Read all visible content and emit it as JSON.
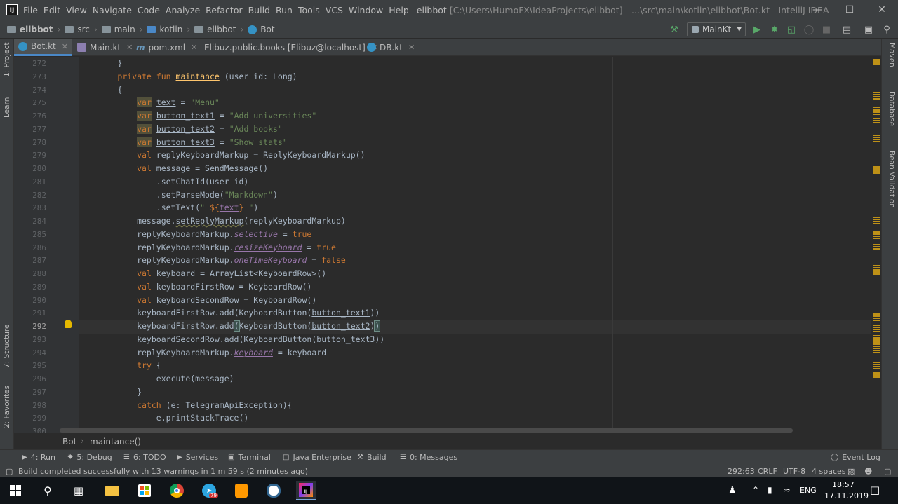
{
  "window": {
    "menu": [
      "File",
      "Edit",
      "View",
      "Navigate",
      "Code",
      "Analyze",
      "Refactor",
      "Build",
      "Run",
      "Tools",
      "VCS",
      "Window",
      "Help"
    ],
    "title_project": "elibbot",
    "title_path": "[C:\\Users\\HumoFX\\IdeaProjects\\elibbot] - ...\\src\\main\\kotlin\\elibbot\\Bot.kt - IntelliJ IDEA",
    "logo_text": "IJ"
  },
  "breadcrumbs": [
    "elibbot",
    "src",
    "main",
    "kotlin",
    "elibbot",
    "Bot"
  ],
  "run_config": "MainKt",
  "tabs": [
    {
      "label": "Bot.kt",
      "active": true
    },
    {
      "label": "Main.kt",
      "active": false
    },
    {
      "label": "pom.xml",
      "active": false
    },
    {
      "label": "Elibuz.public.books [Elibuz@localhost]",
      "active": false
    },
    {
      "label": "DB.kt",
      "active": false
    }
  ],
  "side_left": [
    "1: Project",
    "Learn",
    "7: Structure",
    "2: Favorites"
  ],
  "side_right": [
    "Maven",
    "Database",
    "Bean Validation"
  ],
  "editor": {
    "current_line": 292,
    "lines": [
      {
        "n": "272",
        "c": "        }"
      },
      {
        "n": "273",
        "c": "        private fun maintance (user_id: Long)"
      },
      {
        "n": "274",
        "c": "        {"
      },
      {
        "n": "275",
        "c": "            var text = \"Menu\""
      },
      {
        "n": "276",
        "c": "            var button_text1 = \"Add universities\""
      },
      {
        "n": "277",
        "c": "            var button_text2 = \"Add books\""
      },
      {
        "n": "278",
        "c": "            var button_text3 = \"Show stats\""
      },
      {
        "n": "279",
        "c": "            val replyKeyboardMarkup = ReplyKeyboardMarkup()"
      },
      {
        "n": "280",
        "c": "            val message = SendMessage()"
      },
      {
        "n": "281",
        "c": "                .setChatId(user_id)"
      },
      {
        "n": "282",
        "c": "                .setParseMode(\"Markdown\")"
      },
      {
        "n": "283",
        "c": "                .setText(\"_${text}_\")"
      },
      {
        "n": "284",
        "c": "            message.setReplyMarkup(replyKeyboardMarkup)"
      },
      {
        "n": "285",
        "c": "            replyKeyboardMarkup.selective = true"
      },
      {
        "n": "286",
        "c": "            replyKeyboardMarkup.resizeKeyboard = true"
      },
      {
        "n": "287",
        "c": "            replyKeyboardMarkup.oneTimeKeyboard = false"
      },
      {
        "n": "288",
        "c": "            val keyboard = ArrayList<KeyboardRow>()"
      },
      {
        "n": "289",
        "c": "            val keyboardFirstRow = KeyboardRow()"
      },
      {
        "n": "290",
        "c": "            val keyboardSecondRow = KeyboardRow()"
      },
      {
        "n": "291",
        "c": "            keyboardFirstRow.add(KeyboardButton(button_text1))"
      },
      {
        "n": "292",
        "c": "            keyboardFirstRow.add(KeyboardButton(button_text2))"
      },
      {
        "n": "293",
        "c": "            keyboardSecondRow.add(KeyboardButton(button_text3))"
      },
      {
        "n": "294",
        "c": "            replyKeyboardMarkup.keyboard = keyboard"
      },
      {
        "n": "295",
        "c": "            try {"
      },
      {
        "n": "296",
        "c": "                execute(message)"
      },
      {
        "n": "297",
        "c": "            }"
      },
      {
        "n": "298",
        "c": "            catch (e: TelegramApiException){"
      },
      {
        "n": "299",
        "c": "                e.printStackTrace()"
      },
      {
        "n": "300",
        "c": "            }"
      }
    ]
  },
  "editor_breadcrumb": [
    "Bot",
    "maintance()"
  ],
  "toolwindows": [
    {
      "label": "4: Run",
      "icon": "run-icon"
    },
    {
      "label": "5: Debug",
      "icon": "debug-icon"
    },
    {
      "label": "6: TODO",
      "icon": "todo-icon"
    },
    {
      "label": "Services",
      "icon": "services-icon"
    },
    {
      "label": "Terminal",
      "icon": "terminal-icon"
    },
    {
      "label": "Java Enterprise",
      "icon": "java-enterprise-icon"
    },
    {
      "label": "Build",
      "icon": "build-icon"
    },
    {
      "label": "0: Messages",
      "icon": "messages-icon"
    }
  ],
  "event_log": "Event Log",
  "status": {
    "message": "Build completed successfully with 13 warnings in 1 m 59 s (2 minutes ago)",
    "position": "292:63",
    "line_sep": "CRLF",
    "encoding": "UTF-8",
    "indent": "4 spaces"
  },
  "taskbar": {
    "lang": "ENG",
    "time": "18:57",
    "date": "17.11.2019",
    "telegram_badge": "79"
  },
  "colors": {
    "keyword": "#cc7832",
    "string": "#6a8759",
    "function": "#ffc66d",
    "property": "#9876aa",
    "text": "#a9b7c6",
    "accent": "#4a88c7"
  }
}
